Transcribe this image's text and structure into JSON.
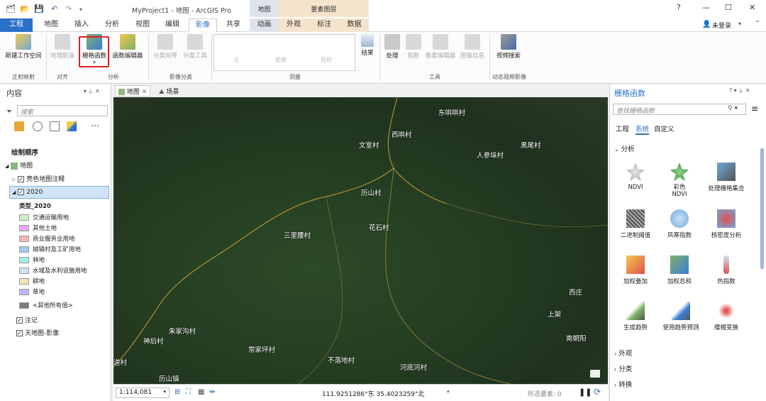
{
  "titlebar": {
    "app_title": "MyProject1 - 地图 - ArcGIS Pro",
    "context_map": "地图",
    "context_feature_layer": "要素图层",
    "help": "?",
    "minimize": "—",
    "maximize": "☐",
    "close": "✕"
  },
  "tabs": [
    "工程",
    "地图",
    "插入",
    "分析",
    "视图",
    "编辑",
    "影像",
    "共享",
    "动画",
    "外观",
    "标注",
    "数据"
  ],
  "account": {
    "label": "未登录",
    "chevron": "▾"
  },
  "ribbon": {
    "new_workspace": "新建工作空间",
    "georef": "地理配准",
    "raster_functions": "栅格函数",
    "function_editor": "函数编辑器",
    "classify_wizard": "分类向导",
    "classify_tools": "分类工具",
    "point": "点",
    "line": "距离",
    "area": "面积",
    "results": "结果",
    "process": "处理",
    "indices": "指数",
    "pixel_editor": "像素编辑器",
    "image_info": "图像信息",
    "video_search": "视频搜索",
    "groups": {
      "ortho": "正射映射",
      "align": "对齐",
      "analysis": "分析",
      "image_class": "影像分类",
      "measure": "测量",
      "tools": "工具",
      "motion_video": "动态视频影像"
    }
  },
  "contents": {
    "title": "内容",
    "search_placeholder": "搜索",
    "draw_order": "绘制顺序",
    "map_node": "地图",
    "layers": {
      "basemap_labels": "亮色地图注释",
      "layer_2020": "2020",
      "class_field": "类型_2020",
      "annotation": "注记",
      "tianditu": "天地图-影像"
    },
    "legend": [
      {
        "label": "交通运输用地",
        "color": "#cdf0c4"
      },
      {
        "label": "其他土地",
        "color": "#e7a8ef"
      },
      {
        "label": "商业服务业用地",
        "color": "#f4b7b0"
      },
      {
        "label": "城镇村及工矿用地",
        "color": "#a9c8ef"
      },
      {
        "label": "林地",
        "color": "#a6ece5"
      },
      {
        "label": "水域及水利设施用地",
        "color": "#cfe2f6"
      },
      {
        "label": "耕地",
        "color": "#f5e4b6"
      },
      {
        "label": "草地",
        "color": "#bdb4f2"
      }
    ],
    "other_values": "<其他所有值>",
    "other_color": "#7a7a7a"
  },
  "map": {
    "tab_map": "地图",
    "tab_scene": "场景",
    "scale": "1:114,081",
    "coords": "111.9251286°东 35.4023259°北",
    "selected": "所选要素: 0",
    "places": [
      {
        "name": "东哄哄村"
      },
      {
        "name": "西哄村"
      },
      {
        "name": "文室村"
      },
      {
        "name": "人参垛村"
      },
      {
        "name": "黑尾村"
      },
      {
        "name": "历山村"
      },
      {
        "name": "三里腰村"
      },
      {
        "name": "花石村"
      },
      {
        "name": "西庄"
      },
      {
        "name": "上架"
      },
      {
        "name": "南朝阳"
      },
      {
        "name": "朱家沟村"
      },
      {
        "name": "神后村"
      },
      {
        "name": "常家坪村"
      },
      {
        "name": "不落地村"
      },
      {
        "name": "河底河村"
      },
      {
        "name": "历山镇"
      },
      {
        "name": "道村"
      }
    ]
  },
  "raster_panel": {
    "title": "栅格函数",
    "search_placeholder": "查找栅格函数",
    "tabs": [
      "工程",
      "系统",
      "自定义"
    ],
    "section_analysis": "分析",
    "functions": [
      "NDVI",
      "彩色\nNDVI",
      "处理栅格集合",
      "二进制阈值",
      "风寒指数",
      "核密度分析",
      "加权叠加",
      "加权总和",
      "热指数",
      "生成趋势",
      "使用趋势预测",
      "缨帽变换"
    ],
    "more_sections": [
      "外观",
      "分类",
      "转换"
    ]
  }
}
